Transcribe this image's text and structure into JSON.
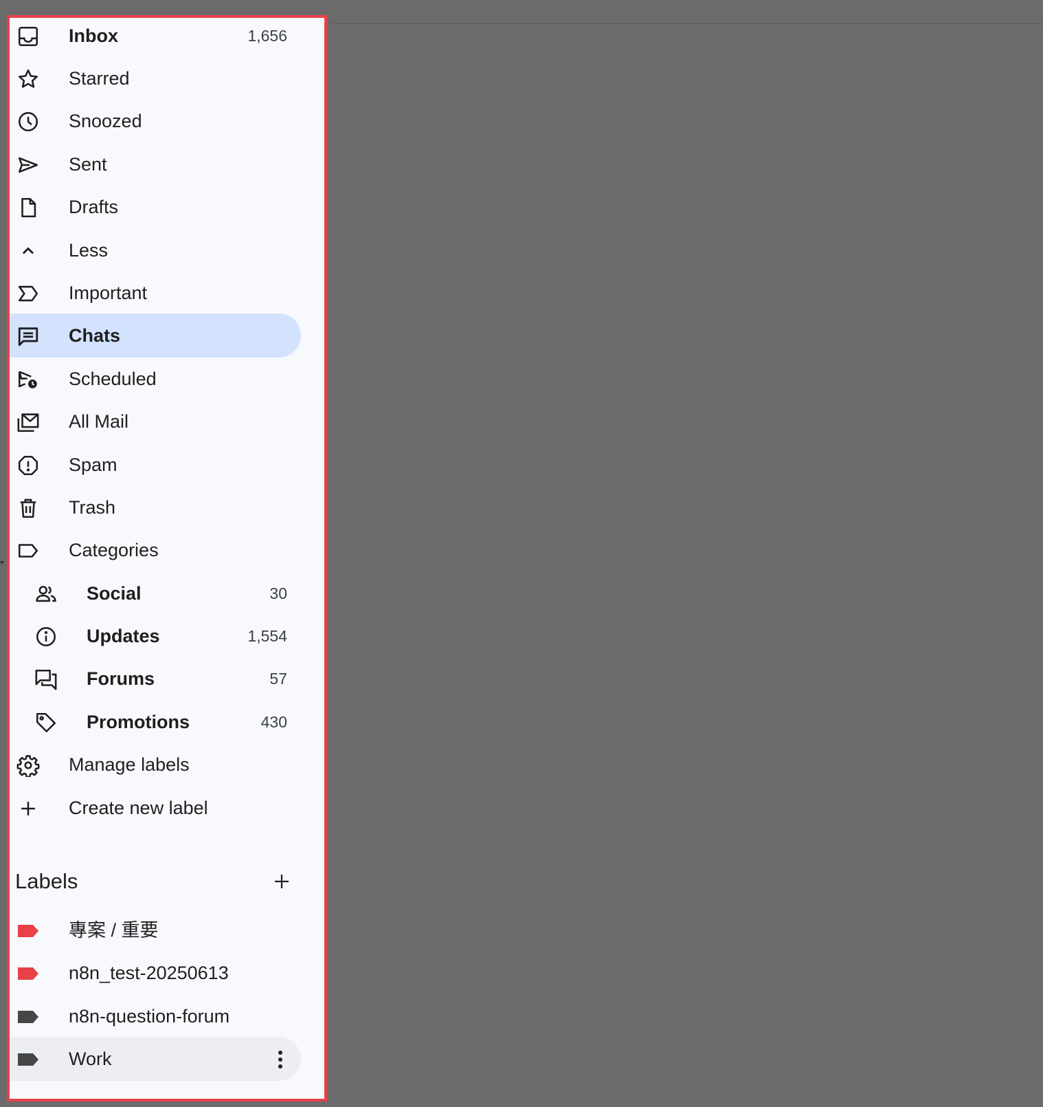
{
  "nav": {
    "items": [
      {
        "label": "Inbox",
        "count": "1,656",
        "icon": "inbox-icon"
      },
      {
        "label": "Starred",
        "icon": "star-icon"
      },
      {
        "label": "Snoozed",
        "icon": "clock-icon"
      },
      {
        "label": "Sent",
        "icon": "send-icon"
      },
      {
        "label": "Drafts",
        "icon": "draft-icon"
      },
      {
        "label": "Less",
        "icon": "chevron-up-icon"
      },
      {
        "label": "Important",
        "icon": "important-icon"
      },
      {
        "label": "Chats",
        "icon": "chat-icon"
      },
      {
        "label": "Scheduled",
        "icon": "scheduled-send-icon"
      },
      {
        "label": "All Mail",
        "icon": "all-mail-icon"
      },
      {
        "label": "Spam",
        "icon": "spam-icon"
      },
      {
        "label": "Trash",
        "icon": "trash-icon"
      },
      {
        "label": "Categories",
        "icon": "label-outline-icon"
      }
    ],
    "categories": [
      {
        "label": "Social",
        "count": "30",
        "icon": "people-icon"
      },
      {
        "label": "Updates",
        "count": "1,554",
        "icon": "info-icon"
      },
      {
        "label": "Forums",
        "count": "57",
        "icon": "forum-icon"
      },
      {
        "label": "Promotions",
        "count": "430",
        "icon": "tag-icon"
      }
    ],
    "actions": [
      {
        "label": "Manage labels",
        "icon": "gear-icon"
      },
      {
        "label": "Create new label",
        "icon": "plus-icon"
      }
    ]
  },
  "labels": {
    "heading": "Labels",
    "items": [
      {
        "label": "專案 / 重要",
        "color": "#e8414a"
      },
      {
        "label": "n8n_test-20250613",
        "color": "#e8414a"
      },
      {
        "label": "n8n-question-forum",
        "color": "#444746"
      },
      {
        "label": "Work",
        "color": "#444746"
      }
    ]
  },
  "colors": {
    "selected_bg": "#d3e3fd",
    "panel_bg": "#f8f9fd",
    "highlight_border": "#e8414a",
    "backdrop": "#6b6b6b"
  }
}
